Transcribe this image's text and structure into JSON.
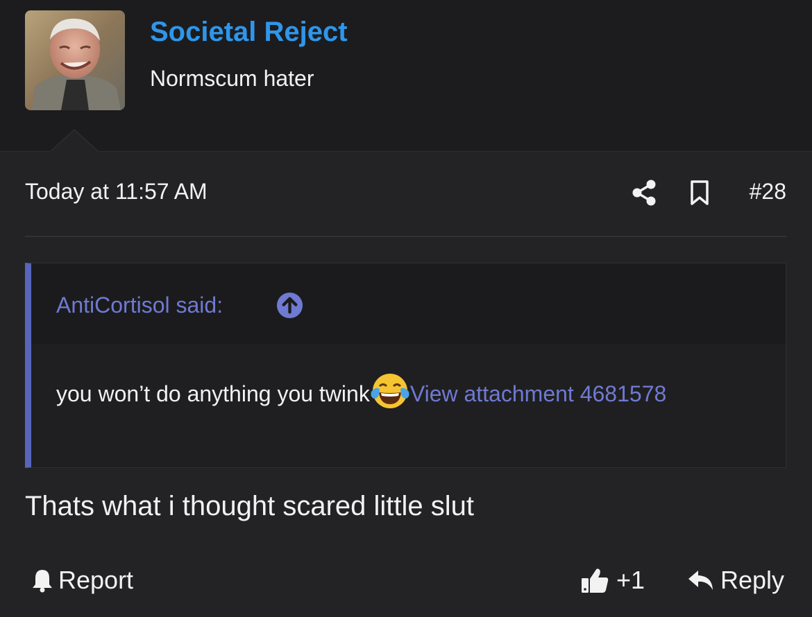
{
  "user": {
    "name": "Societal Reject",
    "title": "Normscum hater",
    "avatar_icon": "user-avatar-photo"
  },
  "post": {
    "timestamp": "Today at 11:57 AM",
    "number": "#28",
    "share_icon": "share-icon",
    "bookmark_icon": "bookmark-icon",
    "body": "Thats what i thought scared little slut"
  },
  "quote": {
    "author": "AntiCortisol said:",
    "text": "you won’t do anything you twink",
    "emoji": "face-with-tears-of-joy",
    "attachment_link": "View attachment 4681578"
  },
  "footer": {
    "report_label": "Report",
    "like_label": "+1",
    "reply_label": "Reply"
  },
  "colors": {
    "background": "#232325",
    "header_bg": "#1c1c1e",
    "username": "#2f96ea",
    "link": "#6f7ad2",
    "quote_accent": "#5766bb",
    "text": "#f2f2f2"
  }
}
